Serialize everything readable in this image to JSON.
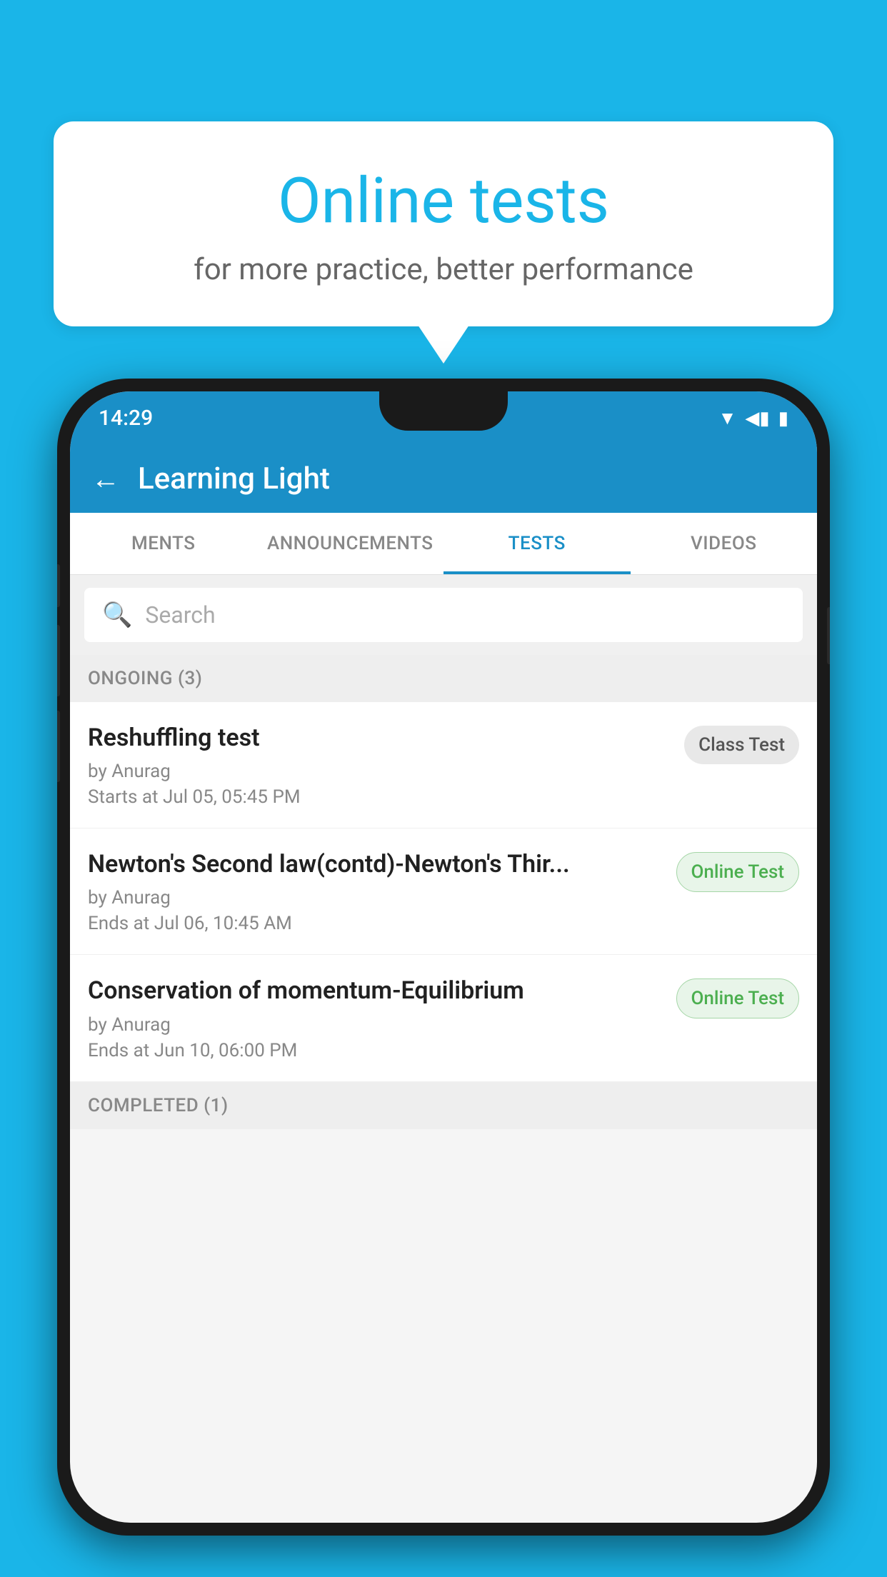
{
  "background_color": "#1ab5e8",
  "bubble": {
    "title": "Online tests",
    "subtitle": "for more practice, better performance"
  },
  "phone": {
    "status_bar": {
      "time": "14:29",
      "icons": [
        "wifi",
        "signal",
        "battery"
      ]
    },
    "header": {
      "back_label": "←",
      "title": "Learning Light"
    },
    "tabs": [
      {
        "label": "MENTS",
        "active": false
      },
      {
        "label": "ANNOUNCEMENTS",
        "active": false
      },
      {
        "label": "TESTS",
        "active": true
      },
      {
        "label": "VIDEOS",
        "active": false
      }
    ],
    "search": {
      "placeholder": "Search",
      "icon": "🔍"
    },
    "ongoing_section": {
      "label": "ONGOING (3)"
    },
    "tests": [
      {
        "name": "Reshuffling test",
        "author": "by Anurag",
        "time_label": "Starts at",
        "time": "Jul 05, 05:45 PM",
        "badge": "Class Test",
        "badge_type": "class"
      },
      {
        "name": "Newton's Second law(contd)-Newton's Thir...",
        "author": "by Anurag",
        "time_label": "Ends at",
        "time": "Jul 06, 10:45 AM",
        "badge": "Online Test",
        "badge_type": "online"
      },
      {
        "name": "Conservation of momentum-Equilibrium",
        "author": "by Anurag",
        "time_label": "Ends at",
        "time": "Jun 10, 06:00 PM",
        "badge": "Online Test",
        "badge_type": "online"
      }
    ],
    "completed_section": {
      "label": "COMPLETED (1)"
    }
  }
}
